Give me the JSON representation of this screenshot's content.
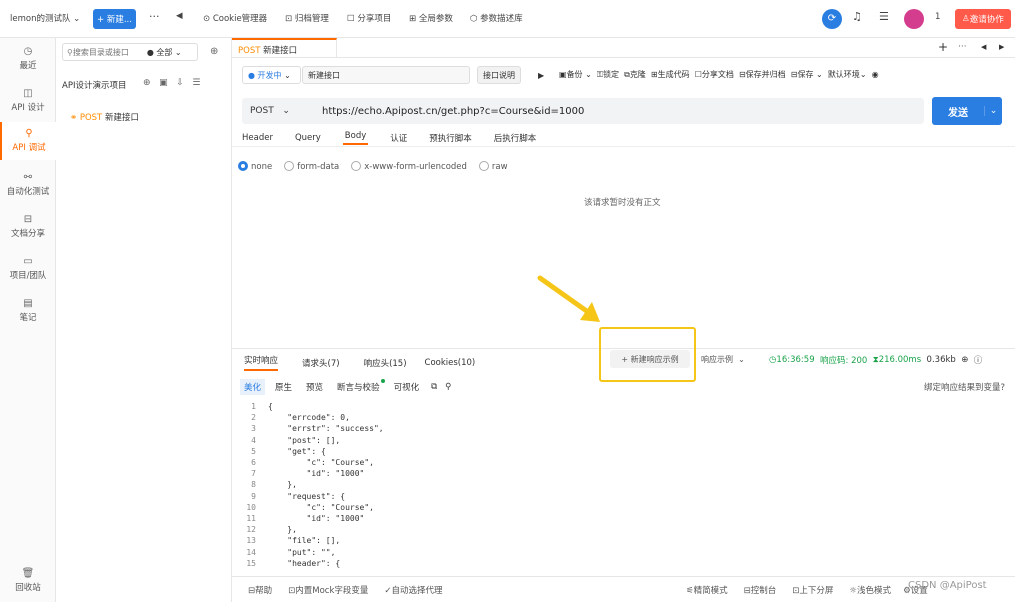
{
  "topbar": {
    "team": "lemon的测试队",
    "new_button": "+ 新建...",
    "more": "···",
    "back": "◀",
    "cookie_manager": "Cookie管理器",
    "archive_manager": "归档管理",
    "share_project": "分享项目",
    "global_params": "全局参数",
    "param_desc_lib": "参数描述库",
    "badge_count": "1",
    "invite_button": "邀请协作"
  },
  "sidebar": {
    "items": [
      {
        "label": "最近",
        "icon": "clock-icon"
      },
      {
        "label": "API 设计",
        "icon": "design-icon"
      },
      {
        "label": "API 调试",
        "icon": "debug-icon"
      },
      {
        "label": "自动化测试",
        "icon": "automation-icon"
      },
      {
        "label": "文档分享",
        "icon": "doc-share-icon"
      },
      {
        "label": "项目/团队",
        "icon": "team-icon"
      },
      {
        "label": "笔记",
        "icon": "note-icon"
      }
    ],
    "trash": "回收站"
  },
  "tree": {
    "search_placeholder": "搜索目录或接口",
    "filter": "● 全部",
    "project": "API设计演示项目",
    "item_method": "POST",
    "item_name": "新建接口"
  },
  "tab": {
    "method": "POST",
    "name": "新建接口"
  },
  "request": {
    "status": "● 开发中",
    "name": "新建接口",
    "doc_button": "接口说明",
    "actions": [
      "备份",
      "锁定",
      "克隆",
      "生成代码",
      "分享文档",
      "保存并归档",
      "保存"
    ],
    "env": "默认环境",
    "method": "POST",
    "url": "https://echo.Apipost.cn/get.php?c=Course&id=1000",
    "send": "发送"
  },
  "req_tabs": [
    "Header",
    "Query",
    "Body",
    "认证",
    "预执行脚本",
    "后执行脚本"
  ],
  "body_types": [
    "none",
    "form-data",
    "x-www-form-urlencoded",
    "raw"
  ],
  "empty_body": "该请求暂时没有正文",
  "response": {
    "tabs": [
      "实时响应",
      "请求头(7)",
      "响应头(15)",
      "Cookies(10)"
    ],
    "new_example": "+ 新建响应示例",
    "example_select": "响应示例",
    "time": "16:36:59",
    "code_label": "响应码: 200",
    "duration": "216.00ms",
    "size": "0.36kb",
    "view_tabs": [
      "美化",
      "原生",
      "预览",
      "断言与校验",
      "可视化"
    ],
    "bind_link": "绑定响应结果到变量?"
  },
  "code_lines": [
    "{",
    "    \"errcode\": 0,",
    "    \"errstr\": \"success\",",
    "    \"post\": [],",
    "    \"get\": {",
    "        \"c\": \"Course\",",
    "        \"id\": \"1000\"",
    "    },",
    "    \"request\": {",
    "        \"c\": \"Course\",",
    "        \"id\": \"1000\"",
    "    },",
    "    \"file\": [],",
    "    \"put\": \"\",",
    "    \"header\": {"
  ],
  "footer": {
    "help": "帮助",
    "mock_vars": "内置Mock字段变量",
    "auto_proxy": "自动选择代理",
    "simple_mode": "精简模式",
    "console": "控制台",
    "split": "上下分屏",
    "theme": "浅色模式",
    "settings": "设置",
    "watermark": "CSDN @ApiPost"
  },
  "colors": {
    "accent": "#ff6a00",
    "primary": "#2a7de1",
    "highlight": "#f5c518"
  }
}
